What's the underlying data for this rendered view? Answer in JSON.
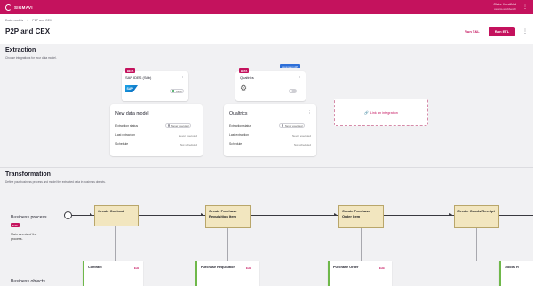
{
  "topbar": {
    "brand": "SIGMAVI",
    "user_name": "Claire Hendfield",
    "user_org": "celonis-workbench"
  },
  "header": {
    "breadcrumbs": [
      "Data models",
      ">",
      "P2P and CEX"
    ],
    "title": "P2P and CEX",
    "run_test_label": "Run T&L",
    "run_etl_label": "Run ETL"
  },
  "extraction": {
    "title": "Extraction",
    "subtitle": "Choose integrations for your data model.",
    "integrations": [
      {
        "badge": "BETA",
        "name": "SAP IDES (Sdb)",
        "logo": "SAP",
        "status": "Used",
        "status_color": "#2e9e4d"
      },
      {
        "badge": "BETA",
        "badge2": "Ecosystem API",
        "name": "Qualtrics",
        "icon": "gear-icon"
      }
    ],
    "models": [
      {
        "title": "New data model",
        "rows": [
          {
            "label": "Extraction status",
            "value": "Never executed"
          },
          {
            "label": "Last extraction",
            "value": "Never executed"
          },
          {
            "label": "Schedule",
            "value": "Not scheduled"
          }
        ]
      },
      {
        "title": "Qualtrics",
        "rows": [
          {
            "label": "Extraction status",
            "value": "Never executed"
          },
          {
            "label": "Last extraction",
            "value": "Never executed"
          },
          {
            "label": "Schedule",
            "value": "Not scheduled"
          }
        ]
      }
    ],
    "link_label": "Link an integration"
  },
  "transformation": {
    "title": "Transformation",
    "subtitle": "Define your business process and model the extracted data in business objects.",
    "bp_label": "Business process",
    "bp_edit": "Edit",
    "bp_desc": "Main events of the process.",
    "bo_label": "Business objects",
    "events": [
      "Create Contract",
      "Create Purchase Requisition Item",
      "Create Purchase Order Item",
      "Create Goods Receipt"
    ],
    "objects": [
      {
        "name": "Contract",
        "edit": "Edit"
      },
      {
        "name": "Purchase Requisition",
        "edit": "Edit"
      },
      {
        "name": "Purchase Order",
        "edit": "Edit"
      },
      {
        "name": "Goods R",
        "edit": ""
      }
    ]
  },
  "colors": {
    "brand": "#c4125d",
    "event_fill": "#f2e6bf",
    "object_accent": "#6fb84a"
  }
}
